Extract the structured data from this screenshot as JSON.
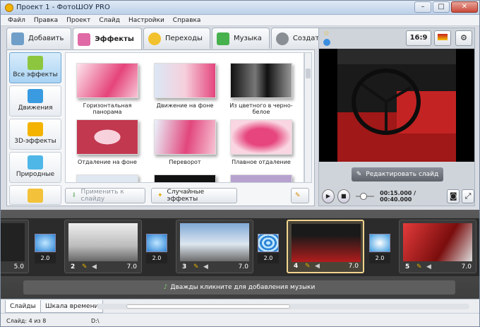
{
  "window": {
    "title": "Проект 1 - ФотоШОУ PRO",
    "minimize": "–",
    "maximize": "□",
    "close": "✕"
  },
  "menu": [
    "Файл",
    "Правка",
    "Проект",
    "Слайд",
    "Настройки",
    "Справка"
  ],
  "tabs": [
    {
      "label": "Добавить",
      "color": "#6f9fc8"
    },
    {
      "label": "Эффекты",
      "color": "#e06aa6"
    },
    {
      "label": "Переходы",
      "color": "#f2c12e"
    },
    {
      "label": "Музыка",
      "color": "#47b14d"
    },
    {
      "label": "Создать",
      "color": "#8a8f96"
    }
  ],
  "categories": [
    {
      "label": "Все эффекты",
      "color": "#8cc63f"
    },
    {
      "label": "Движения",
      "color": "#3a9be0"
    },
    {
      "label": "3D-эффекты",
      "color": "#f3b300"
    },
    {
      "label": "Природные",
      "color": "#4fb6e8"
    },
    {
      "label": "",
      "color": "#f3c23a"
    }
  ],
  "effects": [
    {
      "label": "Горизонтальная панорама"
    },
    {
      "label": "Движение на фоне"
    },
    {
      "label": "Из цветного в черно-белое"
    },
    {
      "label": "Отдаление на фоне"
    },
    {
      "label": "Переворот"
    },
    {
      "label": "Плавное отдаление"
    }
  ],
  "buttons": {
    "apply": "Применить к слайду",
    "random": "Случайные эффекты",
    "edit_slide": "Редактировать слайд",
    "aspect": "16:9"
  },
  "player": {
    "time": "00:15.000 / 00:40.000"
  },
  "slides": [
    {
      "number": "",
      "duration": "5.0"
    },
    {
      "number": "2",
      "duration": "7.0"
    },
    {
      "number": "3",
      "duration": "7.0"
    },
    {
      "number": "4",
      "duration": "7.0"
    },
    {
      "number": "5",
      "duration": "7.0"
    }
  ],
  "transitions": [
    "2.0",
    "2.0",
    "2.0",
    "2.0"
  ],
  "music_hint": "Дважды кликните для добавления музыки",
  "bottom_tabs": [
    "Слайды",
    "Шкала времени"
  ],
  "status": {
    "slide": "Слайд: 4 из 8",
    "path": "D:\\"
  }
}
